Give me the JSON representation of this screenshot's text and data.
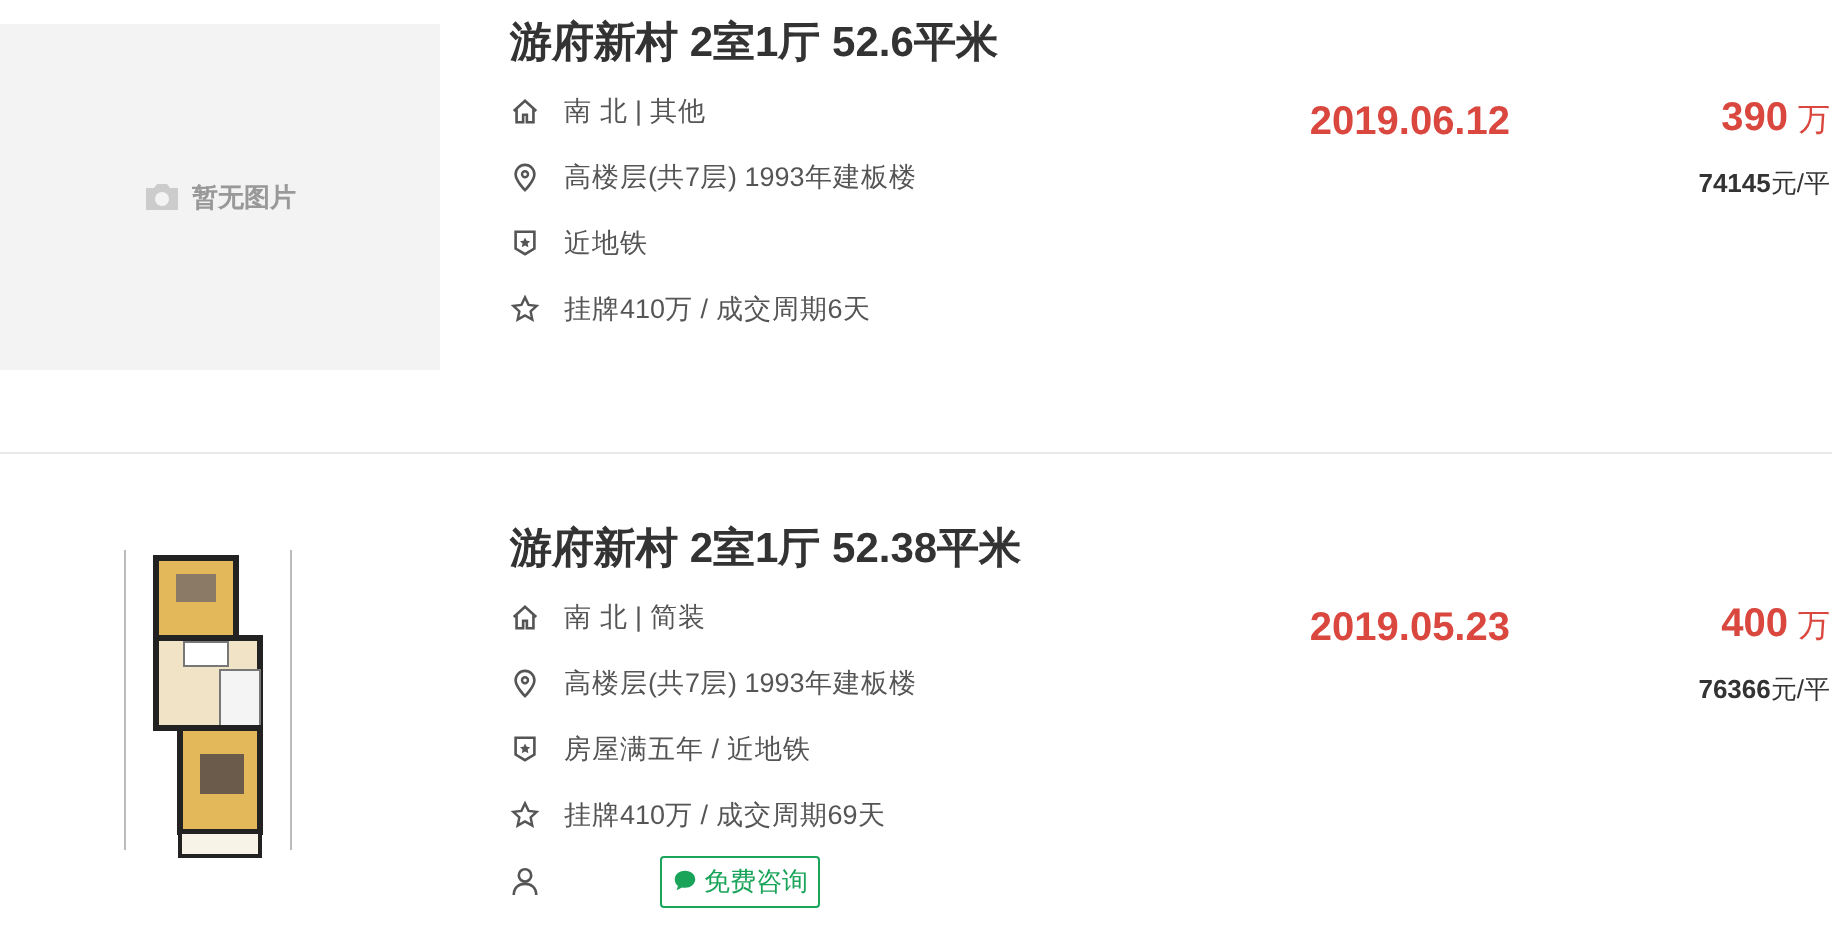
{
  "listings": [
    {
      "image": {
        "kind": "placeholder",
        "text": "暂无图片"
      },
      "title": "游府新村 2室1厅 52.6平米",
      "rows": [
        {
          "kind": "house",
          "text": "南 北 | 其他"
        },
        {
          "kind": "location",
          "text": "高楼层(共7层) 1993年建板楼"
        },
        {
          "kind": "badge",
          "text": "近地铁"
        },
        {
          "kind": "star",
          "text": "挂牌410万 / 成交周期6天"
        }
      ],
      "date": "2019.06.12",
      "price": "390",
      "unit": "万",
      "unit_price": "**74145**元/平"
    },
    {
      "title": "游府新村 2室1厅 52.38平米",
      "rows": [
        {
          "kind": "house",
          "text": "南 北 | 简装"
        },
        {
          "kind": "location",
          "text": "高楼层(共7层) 1993年建板楼"
        },
        {
          "kind": "badge",
          "text": "房屋满五年 / 近地铁"
        },
        {
          "kind": "star",
          "text": "挂牌410万 / 成交周期69天"
        }
      ],
      "agent": {
        "button": "免费咨询"
      },
      "date": "2019.05.23",
      "price": "400",
      "unit": "万",
      "unit_price": "**76366**元/平"
    }
  ]
}
